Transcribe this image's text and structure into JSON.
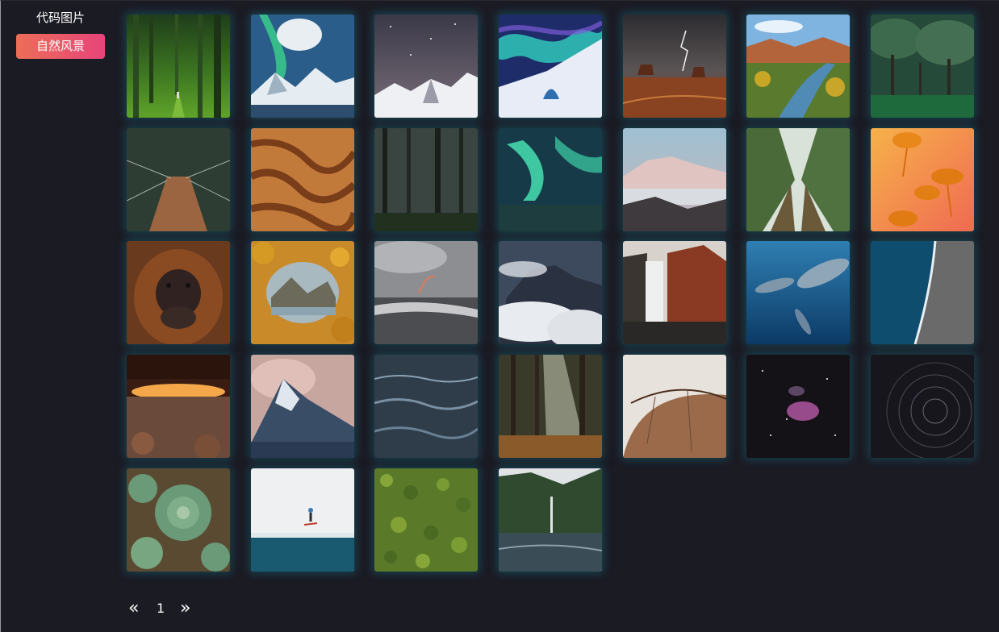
{
  "sidebar": {
    "title": "代码图片",
    "items": [
      {
        "label": "自然风景",
        "active": true,
        "accent": "#e95a6a"
      }
    ]
  },
  "gallery": {
    "images": [
      {
        "name": "bamboo-forest-path-image"
      },
      {
        "name": "aurora-over-snowy-mountains-image"
      },
      {
        "name": "starry-night-snow-peaks-image"
      },
      {
        "name": "aurora-ice-tunnel-image"
      },
      {
        "name": "desert-buttes-lightning-image"
      },
      {
        "name": "canyon-river-valley-image"
      },
      {
        "name": "green-tree-park-image"
      },
      {
        "name": "suspension-bridge-forest-image"
      },
      {
        "name": "orange-sand-dunes-image"
      },
      {
        "name": "dark-misty-forest-image"
      },
      {
        "name": "green-aurora-night-image"
      },
      {
        "name": "misty-mountain-range-image"
      },
      {
        "name": "tall-forest-canopy-image"
      },
      {
        "name": "orange-jellyfish-image"
      },
      {
        "name": "orangutan-portrait-image"
      },
      {
        "name": "autumn-leaves-lake-frame-image"
      },
      {
        "name": "rainbow-over-beach-image"
      },
      {
        "name": "cloud-covered-peak-image"
      },
      {
        "name": "waterfall-red-cliff-image"
      },
      {
        "name": "underwater-dolphins-image"
      },
      {
        "name": "black-sand-coastline-aerial-image"
      },
      {
        "name": "glowing-arch-canyon-image"
      },
      {
        "name": "sunset-snow-mountain-image"
      },
      {
        "name": "dark-ocean-waves-image"
      },
      {
        "name": "sunbeam-forest-image"
      },
      {
        "name": "dry-leaf-closeup-image"
      },
      {
        "name": "pink-nebula-stars-image"
      },
      {
        "name": "star-trails-image"
      },
      {
        "name": "succulent-plants-image"
      },
      {
        "name": "kitesurfer-ocean-image"
      },
      {
        "name": "aerial-pine-forest-image"
      },
      {
        "name": "fjord-waterfall-image"
      }
    ]
  },
  "pagination": {
    "prev": "«",
    "page": "1",
    "next": "»"
  }
}
